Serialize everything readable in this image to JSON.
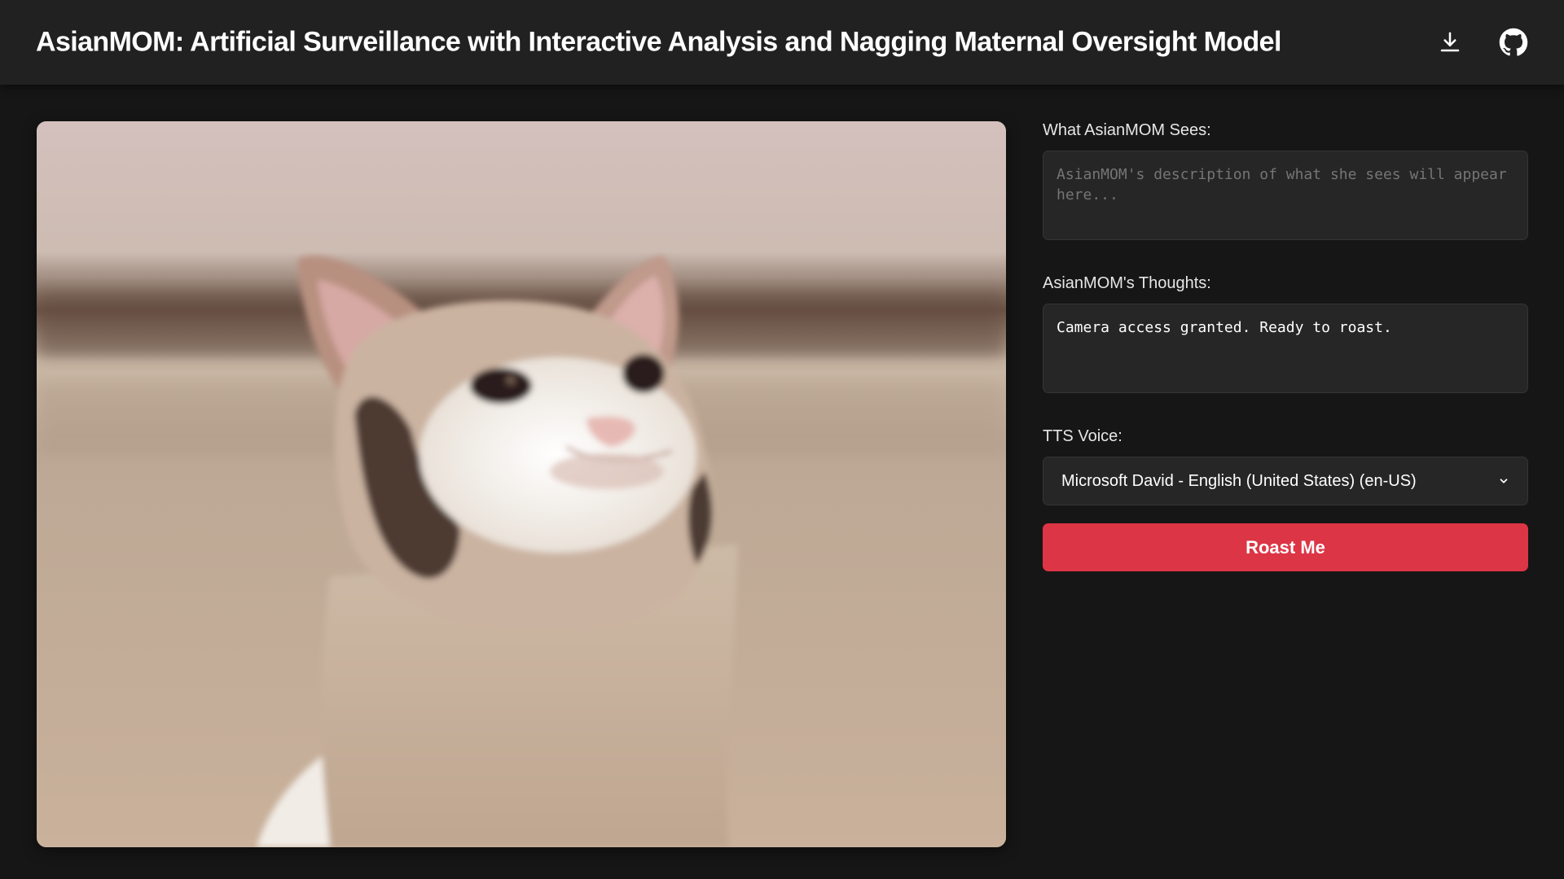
{
  "header": {
    "title": "AsianMOM: Artificial Surveillance with Interactive Analysis and Nagging Maternal Oversight Model",
    "download_icon": "download-icon",
    "github_icon": "github-icon"
  },
  "camera": {
    "subject": "cat-webcam-feed"
  },
  "panel": {
    "sees_label": "What AsianMOM Sees:",
    "sees_placeholder": "AsianMOM's description of what she sees will appear here...",
    "thoughts_label": "AsianMOM's Thoughts:",
    "thoughts_value": "Camera access granted. Ready to roast.",
    "tts_label": "TTS Voice:",
    "tts_selected": "Microsoft David - English (United States) (en-US)",
    "roast_button": "Roast Me"
  },
  "colors": {
    "background": "#161616",
    "header": "#212121",
    "field_bg": "#262626",
    "accent_red": "#dc3545"
  }
}
